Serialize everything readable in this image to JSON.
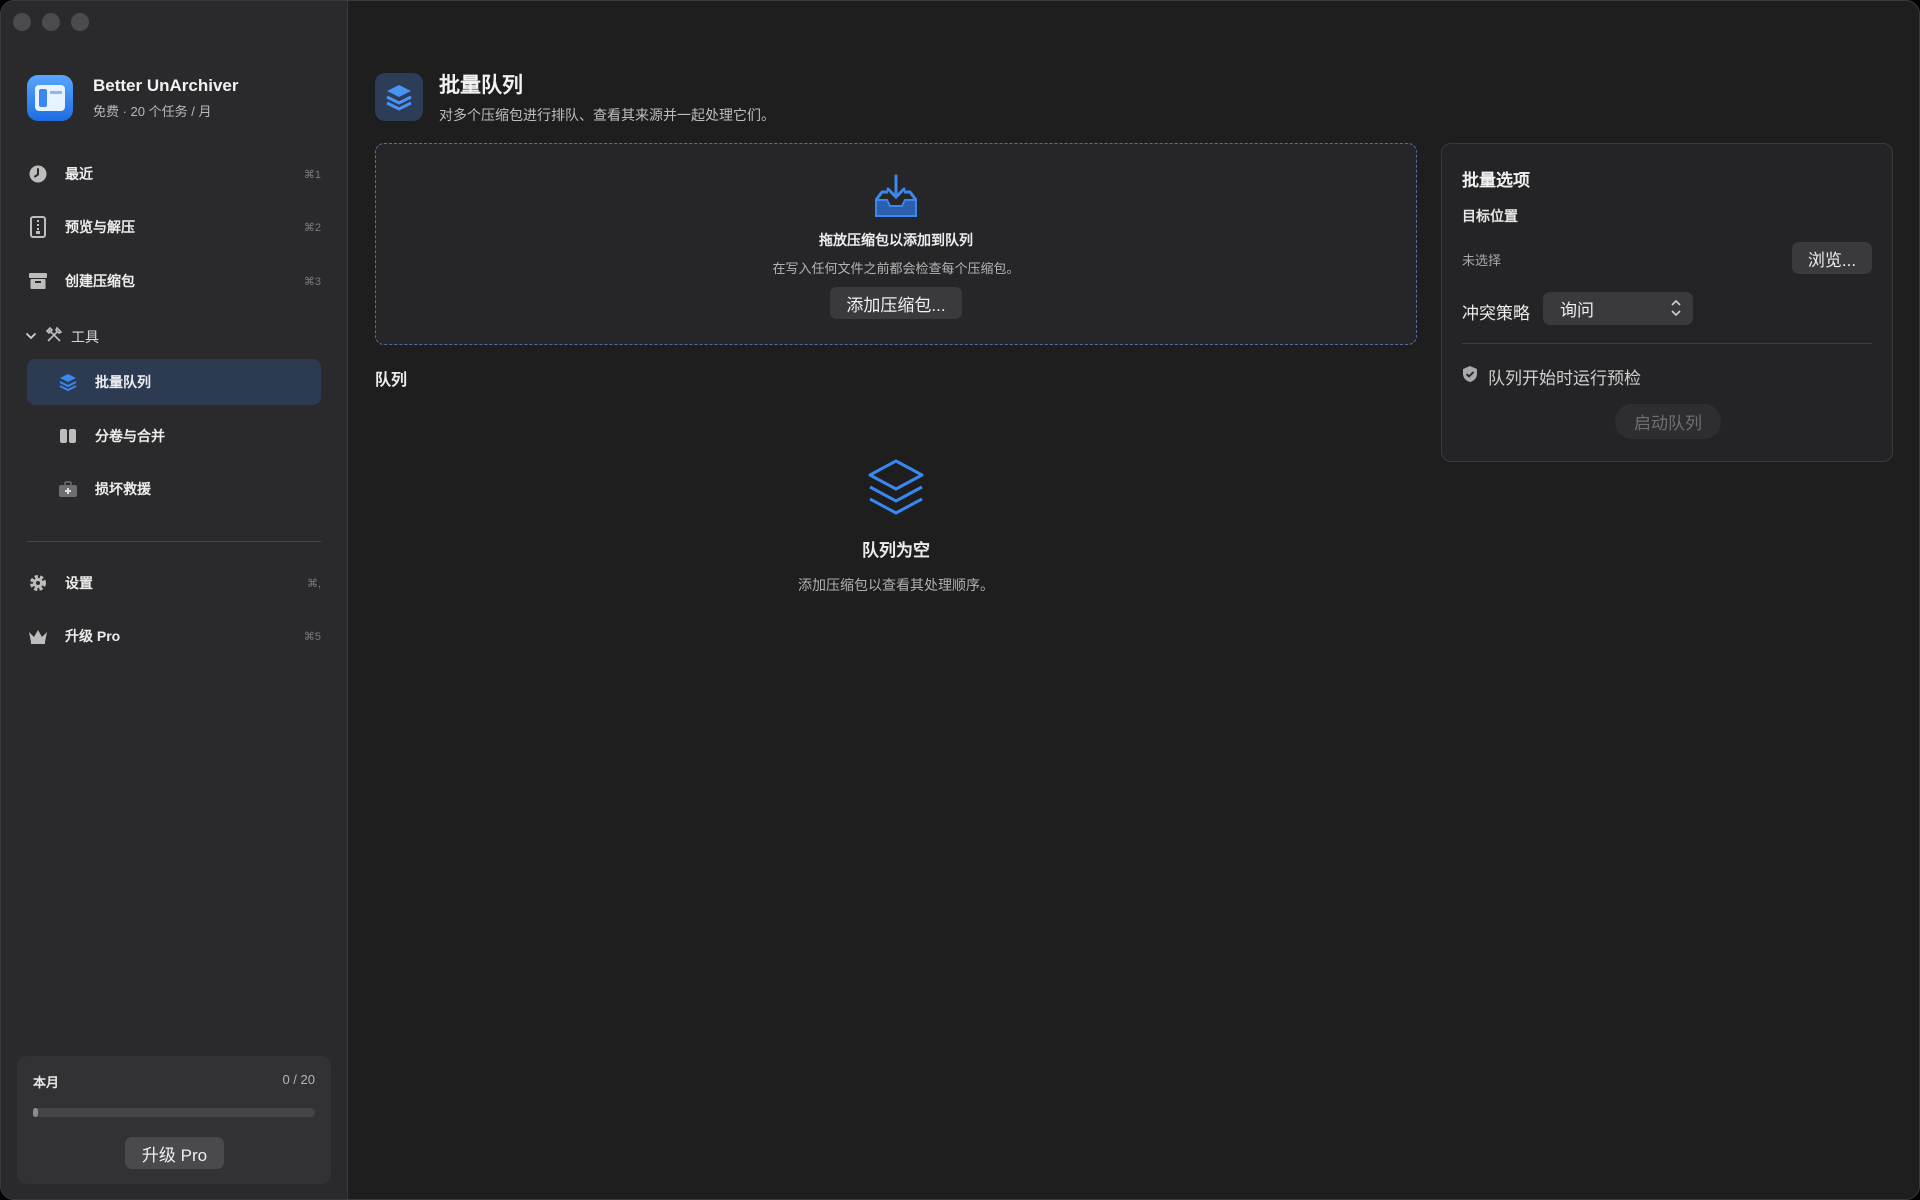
{
  "app": {
    "name": "Better UnArchiver",
    "plan": "免费 · 20 个任务 / 月"
  },
  "sidebar": {
    "items": [
      {
        "label": "最近",
        "shortcut": "⌘1",
        "icon": "clock-icon"
      },
      {
        "label": "预览与解压",
        "shortcut": "⌘2",
        "icon": "document-zipper-icon"
      },
      {
        "label": "创建压缩包",
        "shortcut": "⌘3",
        "icon": "archive-box-icon"
      }
    ],
    "tools_section": {
      "label": "工具",
      "icon": "tools-icon",
      "expanded": true
    },
    "tools": [
      {
        "label": "批量队列",
        "icon": "stack-layers-icon",
        "active": true
      },
      {
        "label": "分卷与合并",
        "icon": "split-panes-icon"
      },
      {
        "label": "损坏救援",
        "icon": "medkit-icon"
      }
    ],
    "bottom": [
      {
        "label": "设置",
        "shortcut": "⌘,",
        "icon": "gear-icon"
      },
      {
        "label": "升级 Pro",
        "shortcut": "⌘5",
        "icon": "crown-icon"
      }
    ],
    "usage": {
      "label": "本月",
      "count": "0 / 20",
      "progress_fraction": 0.0,
      "upgrade_label": "升级 Pro"
    }
  },
  "main": {
    "title": "批量队列",
    "subtitle": "对多个压缩包进行排队、查看其来源并一起处理它们。",
    "drop_zone": {
      "title": "拖放压缩包以添加到队列",
      "subtitle": "在写入任何文件之前都会检查每个压缩包。",
      "button": "添加压缩包..."
    },
    "queue_title": "队列",
    "empty": {
      "title": "队列为空",
      "subtitle": "添加压缩包以查看其处理顺序。"
    }
  },
  "options": {
    "title": "批量选项",
    "destination_label": "目标位置",
    "destination_value": "未选择",
    "browse_button": "浏览...",
    "conflict_label": "冲突策略",
    "conflict_value": "询问",
    "preflight_label": "队列开始时运行预检",
    "start_button": "启动队列"
  },
  "colors": {
    "accent": "#3a87f0",
    "active_bg": "#2c3a52",
    "window_bg": "#1e1e1f",
    "sidebar_bg": "#2a2a2c"
  }
}
